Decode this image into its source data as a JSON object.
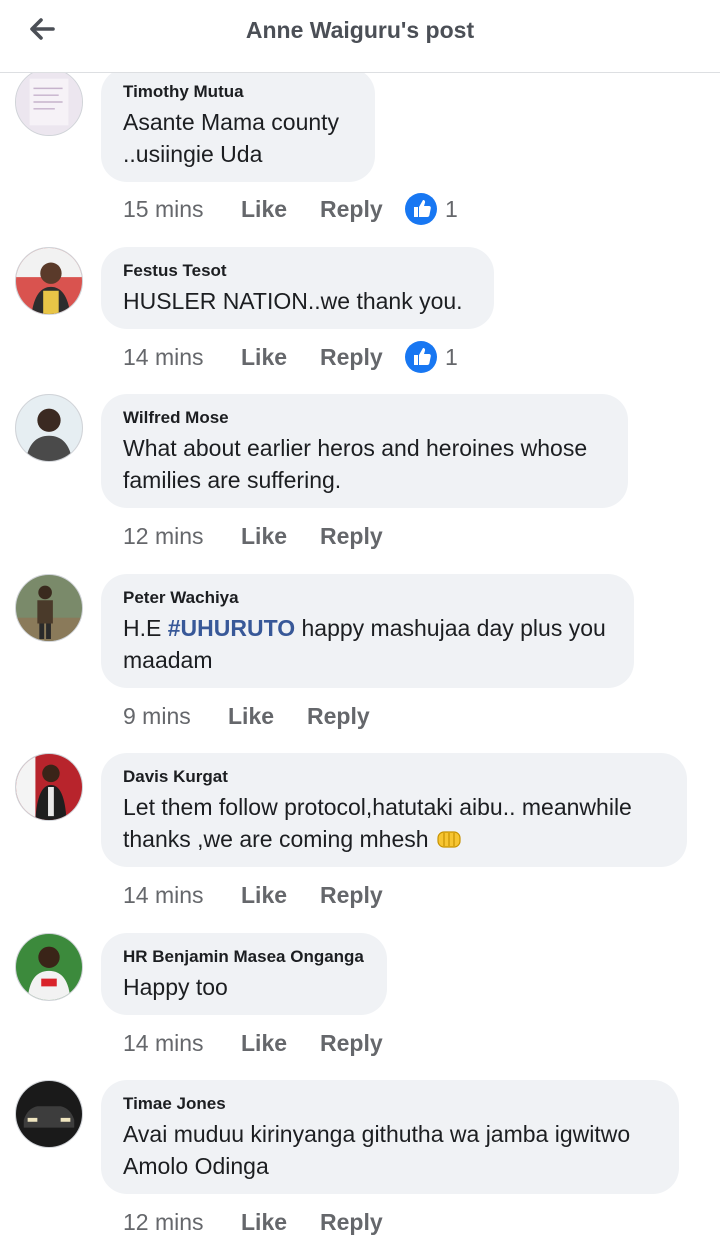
{
  "header": {
    "title": "Anne Waiguru's post",
    "back_icon": "arrow-left-icon"
  },
  "colors": {
    "bubble": "#f0f2f5",
    "meta_text": "#65676b",
    "like_blue": "#1877f2",
    "hashtag": "#385898"
  },
  "comments": [
    {
      "author": "Timothy Mutua",
      "text": "Asante Mama county ..usiingie Uda",
      "time": "15 mins",
      "like": "Like",
      "reply": "Reply",
      "reactions": "1"
    },
    {
      "author": "Festus Tesot",
      "text": "HUSLER NATION..we thank you.",
      "time": "14 mins",
      "like": "Like",
      "reply": "Reply",
      "reactions": "1"
    },
    {
      "author": "Wilfred Mose",
      "text": "What about earlier heros and heroines whose families are suffering.",
      "time": "12 mins",
      "like": "Like",
      "reply": "Reply"
    },
    {
      "author": "Peter Wachiya",
      "text_prefix": "H.E ",
      "hashtag": "#UHURUTO",
      "text_suffix": " happy mashujaa day plus you maadam",
      "time": "9 mins",
      "like": "Like",
      "reply": "Reply"
    },
    {
      "author": "Davis Kurgat",
      "text": "Let them follow protocol,hatutaki aibu.. meanwhile thanks ,we are coming mhesh",
      "emoji": "oncoming-fist-emoji",
      "time": "14 mins",
      "like": "Like",
      "reply": "Reply"
    },
    {
      "author": "HR Benjamin Masea Onganga",
      "text": "Happy too",
      "time": "14 mins",
      "like": "Like",
      "reply": "Reply"
    },
    {
      "author": "Timae Jones",
      "text": "Avai muduu kirinyanga githutha wa jamba igwitwo Amolo Odinga",
      "time": "12 mins",
      "like": "Like",
      "reply": "Reply"
    }
  ]
}
